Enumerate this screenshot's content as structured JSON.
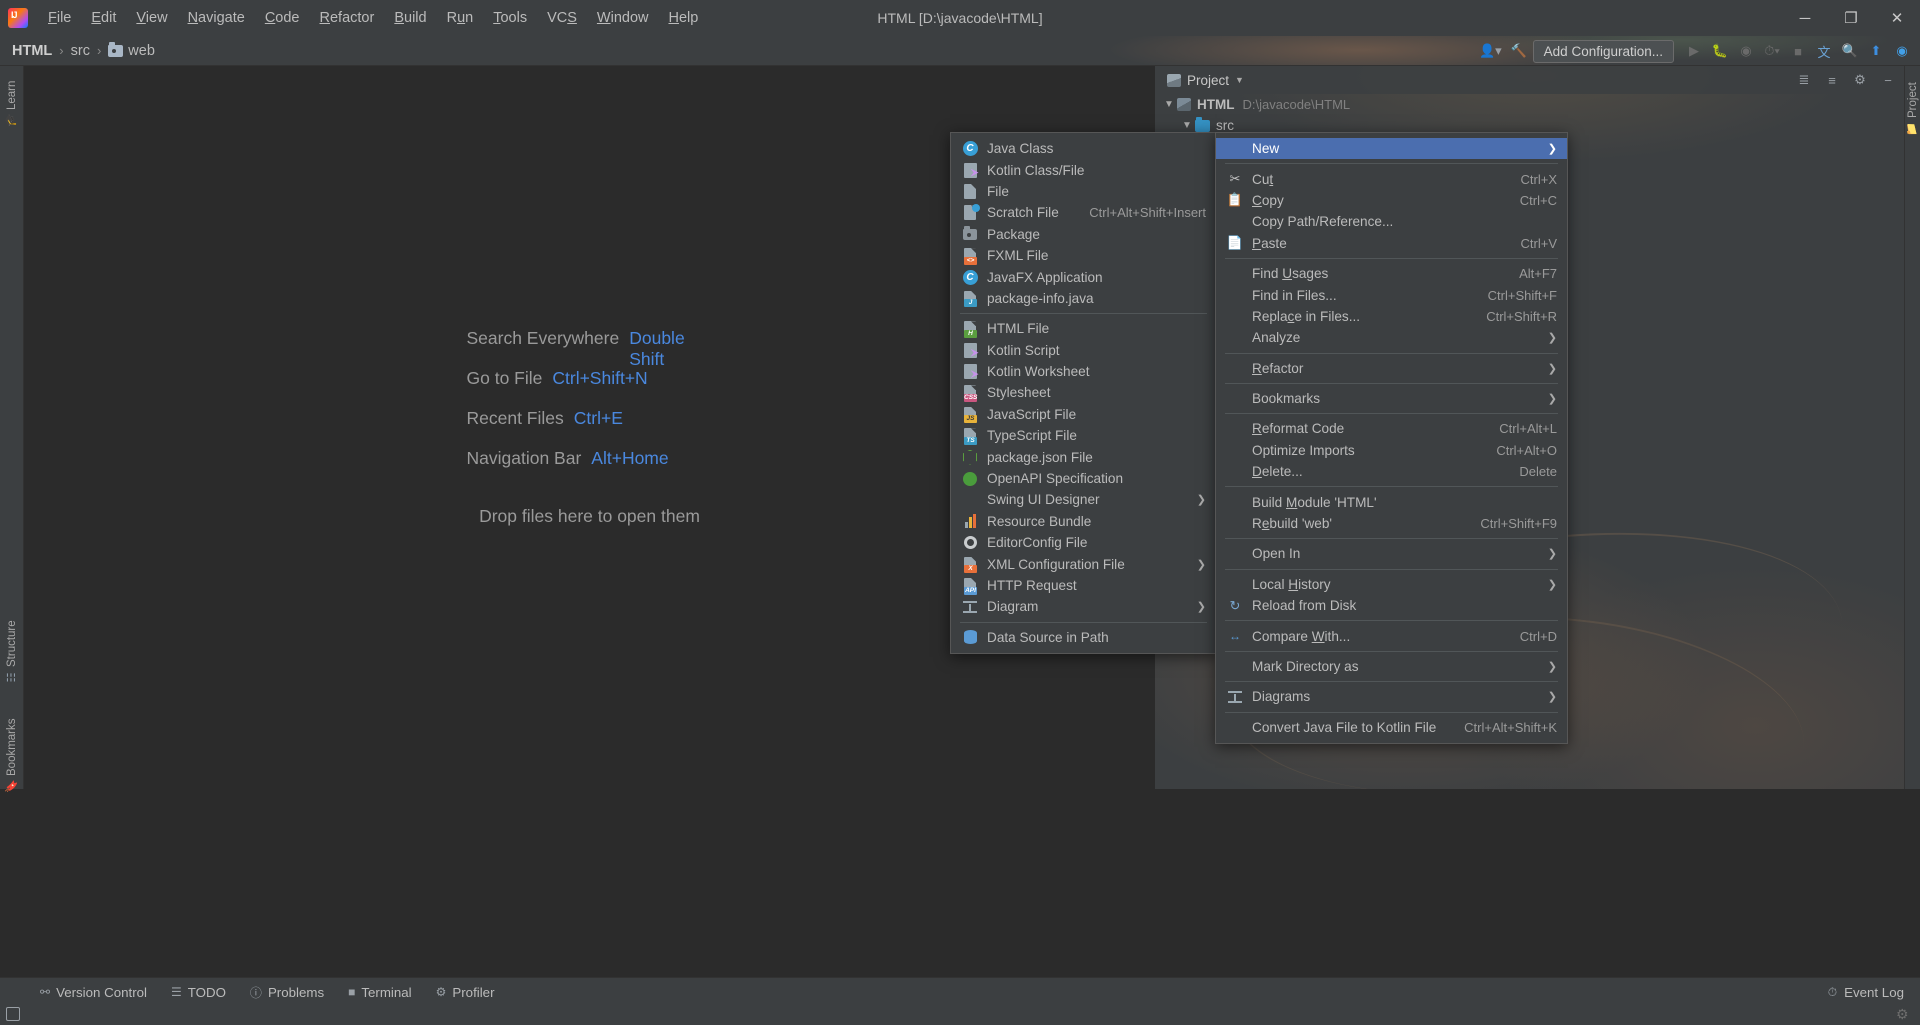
{
  "titlebar": {
    "logo_name": "intellij-logo",
    "window_title": "HTML [D:\\javacode\\HTML]",
    "menus": [
      {
        "label": "File",
        "mnemonic": "F"
      },
      {
        "label": "Edit",
        "mnemonic": "E"
      },
      {
        "label": "View",
        "mnemonic": "V"
      },
      {
        "label": "Navigate",
        "mnemonic": "N"
      },
      {
        "label": "Code",
        "mnemonic": "C"
      },
      {
        "label": "Refactor",
        "mnemonic": "R"
      },
      {
        "label": "Build",
        "mnemonic": "B"
      },
      {
        "label": "Run",
        "mnemonic": "u"
      },
      {
        "label": "Tools",
        "mnemonic": "T"
      },
      {
        "label": "VCS",
        "mnemonic": "S"
      },
      {
        "label": "Window",
        "mnemonic": "W"
      },
      {
        "label": "Help",
        "mnemonic": "H"
      }
    ],
    "minimize": "─",
    "maximize": "❐",
    "close": "✕"
  },
  "navbar": {
    "breadcrumbs": [
      "HTML",
      "src",
      "web"
    ],
    "separator": "›",
    "add_configuration": "Add Configuration...",
    "accent_blue": "#4b6eaf"
  },
  "left_strip": {
    "items": [
      {
        "label": "Learn",
        "icon": "learn-icon"
      },
      {
        "label": "Structure",
        "icon": "structure-icon"
      },
      {
        "label": "Bookmarks",
        "icon": "bookmarks-icon"
      }
    ]
  },
  "right_strip": {
    "items": [
      {
        "label": "Project",
        "icon": "project-icon"
      }
    ]
  },
  "editor": {
    "hints": [
      {
        "label": "Search Everywhere",
        "shortcut": "Double Shift"
      },
      {
        "label": "Go to File",
        "shortcut": "Ctrl+Shift+N"
      },
      {
        "label": "Recent Files",
        "shortcut": "Ctrl+E"
      },
      {
        "label": "Navigation Bar",
        "shortcut": "Alt+Home"
      }
    ],
    "drop_hint": "Drop files here to open them",
    "shortcut_color": "#4a88df"
  },
  "project_panel": {
    "title": "Project",
    "chevron": "▼",
    "tree": [
      {
        "label": "HTML",
        "path": "D:\\javacode\\HTML",
        "expanded": true,
        "type": "module"
      },
      {
        "label": "src",
        "path": "",
        "expanded": true,
        "type": "source-folder"
      }
    ]
  },
  "new_submenu": {
    "name": "new-file-submenu",
    "groups": [
      [
        {
          "label": "Java Class",
          "icon": "java-class-icon",
          "shortcut": ""
        },
        {
          "label": "Kotlin Class/File",
          "icon": "kotlin-file-icon",
          "shortcut": ""
        },
        {
          "label": "File",
          "icon": "file-icon",
          "shortcut": ""
        },
        {
          "label": "Scratch File",
          "icon": "scratch-file-icon",
          "shortcut": "Ctrl+Alt+Shift+Insert"
        },
        {
          "label": "Package",
          "icon": "package-icon",
          "shortcut": ""
        },
        {
          "label": "FXML File",
          "icon": "fxml-file-icon",
          "shortcut": ""
        },
        {
          "label": "JavaFX Application",
          "icon": "javafx-app-icon",
          "shortcut": ""
        },
        {
          "label": "package-info.java",
          "icon": "package-info-icon",
          "shortcut": ""
        }
      ],
      [
        {
          "label": "HTML File",
          "icon": "html-file-icon",
          "shortcut": ""
        },
        {
          "label": "Kotlin Script",
          "icon": "kotlin-script-icon",
          "shortcut": ""
        },
        {
          "label": "Kotlin Worksheet",
          "icon": "kotlin-worksheet-icon",
          "shortcut": ""
        },
        {
          "label": "Stylesheet",
          "icon": "css-file-icon",
          "shortcut": ""
        },
        {
          "label": "JavaScript File",
          "icon": "js-file-icon",
          "shortcut": ""
        },
        {
          "label": "TypeScript File",
          "icon": "ts-file-icon",
          "shortcut": ""
        },
        {
          "label": "package.json File",
          "icon": "nodejs-icon",
          "shortcut": ""
        },
        {
          "label": "OpenAPI Specification",
          "icon": "openapi-icon",
          "shortcut": ""
        },
        {
          "label": "Swing UI Designer",
          "icon": "",
          "shortcut": "",
          "submenu": true
        },
        {
          "label": "Resource Bundle",
          "icon": "resource-bundle-icon",
          "shortcut": ""
        },
        {
          "label": "EditorConfig File",
          "icon": "editorconfig-icon",
          "shortcut": ""
        },
        {
          "label": "XML Configuration File",
          "icon": "xml-file-icon",
          "shortcut": "",
          "submenu": true
        },
        {
          "label": "HTTP Request",
          "icon": "http-request-icon",
          "shortcut": ""
        },
        {
          "label": "Diagram",
          "icon": "diagram-icon",
          "shortcut": "",
          "submenu": true
        }
      ],
      [
        {
          "label": "Data Source in Path",
          "icon": "data-source-icon",
          "shortcut": ""
        }
      ]
    ]
  },
  "context_menu": {
    "name": "project-context-menu",
    "groups": [
      [
        {
          "label": "New",
          "icon": "",
          "shortcut": "",
          "submenu": true,
          "active": true
        }
      ],
      [
        {
          "label": "Cut",
          "icon": "cut-icon",
          "shortcut": "Ctrl+X",
          "mnemonic": "t"
        },
        {
          "label": "Copy",
          "icon": "copy-icon",
          "shortcut": "Ctrl+C",
          "mnemonic": "C"
        },
        {
          "label": "Copy Path/Reference...",
          "icon": "",
          "shortcut": ""
        },
        {
          "label": "Paste",
          "icon": "paste-icon",
          "shortcut": "Ctrl+V",
          "mnemonic": "P"
        }
      ],
      [
        {
          "label": "Find Usages",
          "icon": "",
          "shortcut": "Alt+F7",
          "mnemonic": "U"
        },
        {
          "label": "Find in Files...",
          "icon": "",
          "shortcut": "Ctrl+Shift+F"
        },
        {
          "label": "Replace in Files...",
          "icon": "",
          "shortcut": "Ctrl+Shift+R",
          "mnemonic": "c"
        },
        {
          "label": "Analyze",
          "icon": "",
          "shortcut": "",
          "submenu": true,
          "mnemonic": "z"
        }
      ],
      [
        {
          "label": "Refactor",
          "icon": "",
          "shortcut": "",
          "submenu": true,
          "mnemonic": "R"
        }
      ],
      [
        {
          "label": "Bookmarks",
          "icon": "",
          "shortcut": "",
          "submenu": true
        }
      ],
      [
        {
          "label": "Reformat Code",
          "icon": "",
          "shortcut": "Ctrl+Alt+L",
          "mnemonic": "R"
        },
        {
          "label": "Optimize Imports",
          "icon": "",
          "shortcut": "Ctrl+Alt+O"
        },
        {
          "label": "Delete...",
          "icon": "",
          "shortcut": "Delete",
          "mnemonic": "D"
        }
      ],
      [
        {
          "label": "Build Module 'HTML'",
          "icon": "",
          "shortcut": "",
          "mnemonic": "M"
        },
        {
          "label": "Rebuild 'web'",
          "icon": "",
          "shortcut": "Ctrl+Shift+F9",
          "mnemonic": "e"
        }
      ],
      [
        {
          "label": "Open In",
          "icon": "",
          "shortcut": "",
          "submenu": true
        }
      ],
      [
        {
          "label": "Local History",
          "icon": "",
          "shortcut": "",
          "submenu": true,
          "mnemonic": "H"
        },
        {
          "label": "Reload from Disk",
          "icon": "reload-icon",
          "shortcut": ""
        }
      ],
      [
        {
          "label": "Compare With...",
          "icon": "compare-icon",
          "shortcut": "Ctrl+D",
          "mnemonic": "W"
        }
      ],
      [
        {
          "label": "Mark Directory as",
          "icon": "",
          "shortcut": "",
          "submenu": true
        }
      ],
      [
        {
          "label": "Diagrams",
          "icon": "diagrams-icon",
          "shortcut": "",
          "submenu": true
        }
      ],
      [
        {
          "label": "Convert Java File to Kotlin File",
          "icon": "",
          "shortcut": "Ctrl+Alt+Shift+K"
        }
      ]
    ]
  },
  "statusbar": {
    "items": [
      {
        "label": "Version Control",
        "icon": "vcs-branch-icon"
      },
      {
        "label": "TODO",
        "icon": "todo-list-icon"
      },
      {
        "label": "Problems",
        "icon": "problems-icon"
      },
      {
        "label": "Terminal",
        "icon": "terminal-icon"
      },
      {
        "label": "Profiler",
        "icon": "profiler-icon"
      }
    ],
    "event_log": "Event Log",
    "event_log_icon": "event-log-icon"
  }
}
